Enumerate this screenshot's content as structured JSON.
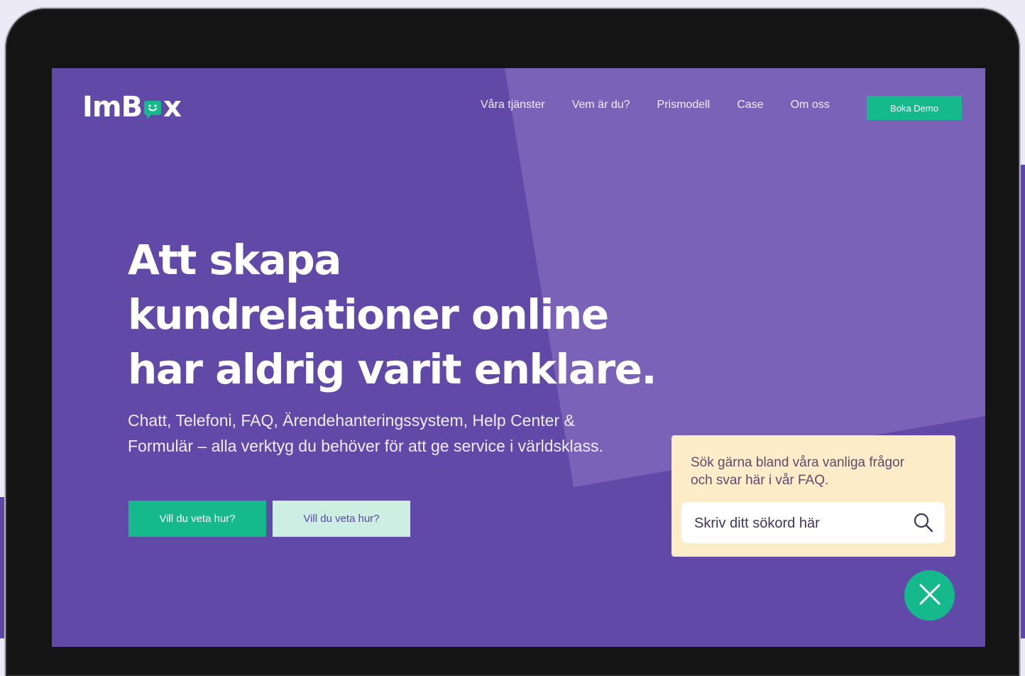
{
  "brand": {
    "logo_text_start": "ImB",
    "logo_text_end": "x",
    "logo_mark": "smiley-chat-bubble-icon"
  },
  "nav": {
    "items": [
      {
        "label": "Våra tjänster"
      },
      {
        "label": "Vem är du?"
      },
      {
        "label": "Prismodell"
      },
      {
        "label": "Case"
      },
      {
        "label": "Om oss"
      }
    ],
    "cta_label": "Boka Demo"
  },
  "hero": {
    "title_lines": [
      "Att skapa",
      "kundrelationer online",
      "har aldrig varit enklare."
    ],
    "subtitle_lines": [
      "Chatt, Telefoni, FAQ, Ärendehanteringssystem, Help Center &",
      "Formulär – alla verktyg du behöver för att ge service i världsklass."
    ],
    "primary_button": "Vill du veta hur?",
    "secondary_button": "Vill du veta hur?"
  },
  "faq_widget": {
    "text_lines": [
      "Sök gärna bland våra vanliga frågor",
      "och svar här i vår FAQ."
    ],
    "search_placeholder": "Skriv ditt sökord här",
    "search_icon": "search-icon",
    "close_icon": "close-icon"
  },
  "colors": {
    "primary": "#6149a8",
    "accent": "#15b98c",
    "secondary_button_bg": "#cdeee3",
    "faq_bg": "#fdecc8",
    "device_frame": "#141414"
  }
}
